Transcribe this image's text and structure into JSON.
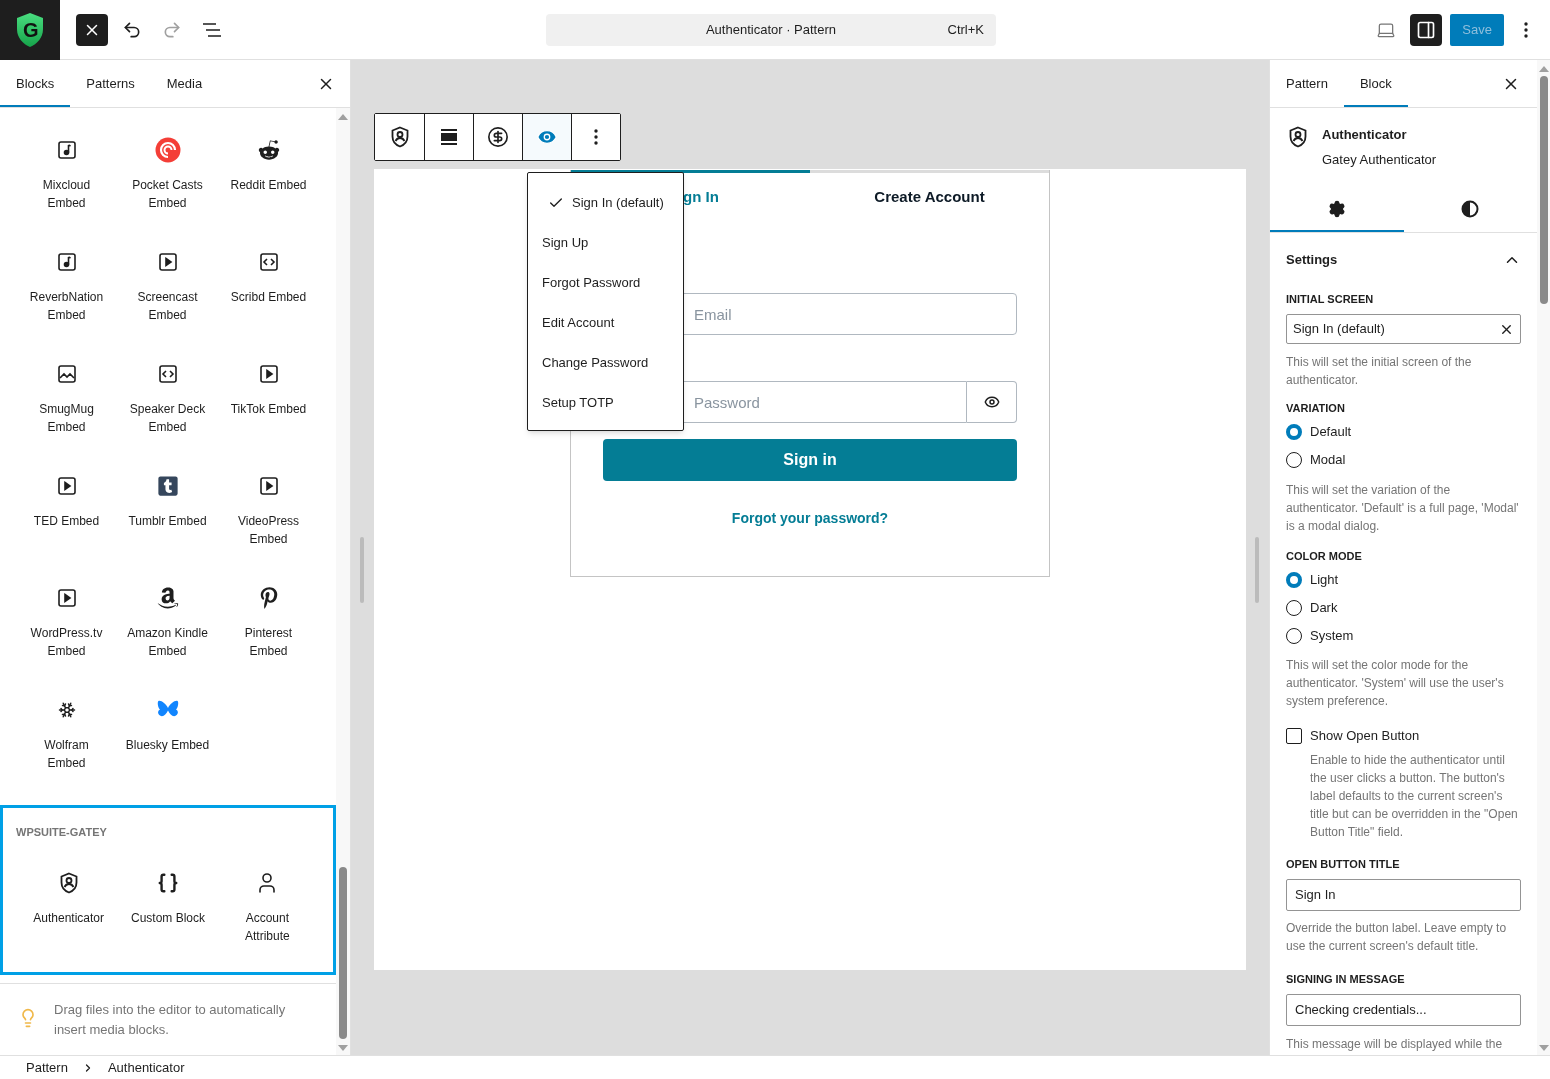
{
  "app_logo": {
    "letter": "G"
  },
  "history": [
    {
      "kind": "undo",
      "disabled": false
    },
    {
      "kind": "redo",
      "disabled": true
    }
  ],
  "command_bar": {
    "title": "Authenticator · Pattern",
    "shortcut": "Ctrl+K"
  },
  "settings_toggle": {
    "pressed": true
  },
  "save_button": {
    "label": "Save",
    "disabled": true
  },
  "inserter": {
    "tabs": [
      {
        "label": "Blocks",
        "selected": true
      },
      {
        "label": "Patterns",
        "selected": false
      },
      {
        "label": "Media",
        "selected": false
      }
    ],
    "blocks": [
      {
        "label": "Mixcloud Embed"
      },
      {
        "label": "Pocket Casts Embed"
      },
      {
        "label": "Reddit Embed"
      },
      {
        "label": "ReverbNation Embed"
      },
      {
        "label": "Screencast Embed"
      },
      {
        "label": "Scribd Embed"
      },
      {
        "label": "SmugMug Embed"
      },
      {
        "label": "Speaker Deck Embed"
      },
      {
        "label": "TikTok Embed"
      },
      {
        "label": "TED Embed"
      },
      {
        "label": "Tumblr Embed"
      },
      {
        "label": "VideoPress Embed"
      },
      {
        "label": "WordPress.tv Embed"
      },
      {
        "label": "Amazon Kindle Embed"
      },
      {
        "label": "Pinterest Embed"
      },
      {
        "label": "Wolfram Embed"
      },
      {
        "label": "Bluesky Embed"
      }
    ],
    "category": {
      "title": "WPSUITE-GATEY",
      "highlighted": true,
      "blocks": [
        {
          "label": "Authenticator"
        },
        {
          "label": "Custom Block"
        },
        {
          "label": "Account Attribute"
        }
      ]
    },
    "tip": "Drag files into the editor to automatically insert media blocks."
  },
  "block_toolbar": {
    "buttons": [
      {
        "kind": "shield",
        "pressed": false
      },
      {
        "kind": "align",
        "pressed": false
      },
      {
        "kind": "dollar",
        "pressed": false
      },
      {
        "kind": "eye",
        "pressed": true
      },
      {
        "kind": "more",
        "pressed": false
      }
    ]
  },
  "screen_menu": {
    "items": [
      {
        "label": "Sign In (default)",
        "selected": true
      },
      {
        "label": "Sign Up",
        "selected": false
      },
      {
        "label": "Forgot Password",
        "selected": false
      },
      {
        "label": "Edit Account",
        "selected": false
      },
      {
        "label": "Change Password",
        "selected": false
      },
      {
        "label": "Setup TOTP",
        "selected": false
      }
    ]
  },
  "authenticator": {
    "tabs": [
      {
        "label": "gn In",
        "selected": true
      },
      {
        "label": "Create Account",
        "selected": false
      }
    ],
    "email_placeholder": "Email",
    "password_placeholder": "Password",
    "submit": "Sign in",
    "forgot_link": "Forgot your password?"
  },
  "sidebar": {
    "tabs": [
      {
        "label": "Pattern",
        "selected": false
      },
      {
        "label": "Block",
        "selected": true
      }
    ],
    "block": {
      "title": "Authenticator",
      "description": "Gatey Authenticator"
    },
    "panel_tabs": [
      {
        "kind": "gear",
        "selected": true
      },
      {
        "kind": "contrast",
        "selected": false
      }
    ],
    "section": {
      "title": "Settings",
      "expanded": true
    },
    "initial_screen": {
      "label": "INITIAL SCREEN",
      "value": "Sign In (default)",
      "help": "This will set the initial screen of the authenticator."
    },
    "variation": {
      "label": "VARIATION",
      "options": [
        {
          "label": "Default",
          "selected": true
        },
        {
          "label": "Modal",
          "selected": false
        }
      ],
      "help": "This will set the variation of the authenticator. 'Default' is a full page, 'Modal' is a modal dialog."
    },
    "color_mode": {
      "label": "COLOR MODE",
      "options": [
        {
          "label": "Light",
          "selected": true
        },
        {
          "label": "Dark",
          "selected": false
        },
        {
          "label": "System",
          "selected": false
        }
      ],
      "help": "This will set the color mode for the authenticator. 'System' will use the user's system preference."
    },
    "show_open_button": {
      "label": "Show Open Button",
      "checked": false,
      "help": "Enable to hide the authenticator until the user clicks a button. The button's label defaults to the current screen's title but can be overridden in the \"Open Button Title\" field."
    },
    "open_button_title": {
      "label": "OPEN BUTTON TITLE",
      "value": "Sign In",
      "help": "Override the button label. Leave empty to use the current screen's default title."
    },
    "signing_in_message": {
      "label": "SIGNING IN MESSAGE",
      "value": "Checking credentials...",
      "help": "This message will be displayed while the"
    }
  },
  "breadcrumb": [
    "Pattern",
    "Authenticator"
  ]
}
